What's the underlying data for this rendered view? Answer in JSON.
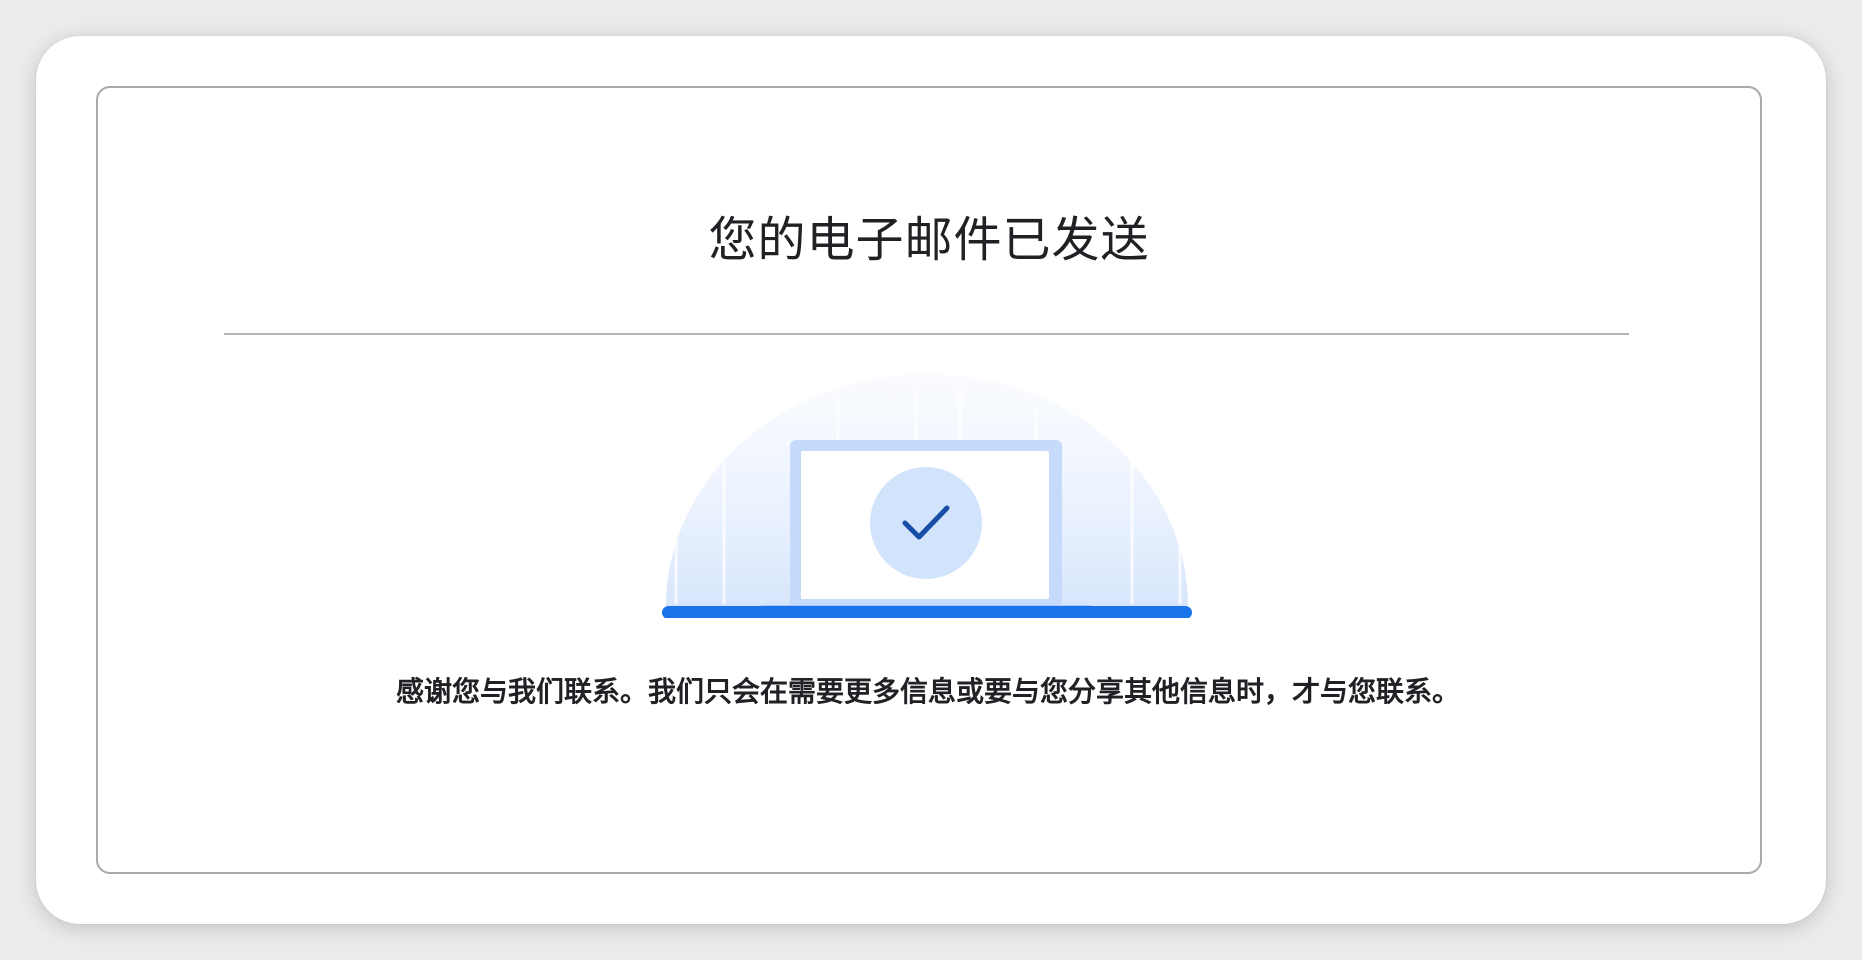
{
  "confirmation": {
    "title": "您的电子邮件已发送",
    "message": "感谢您与我们联系。我们只会在需要更多信息或要与您分享其他信息时，才与您联系。"
  },
  "illustration": {
    "icons": [
      "laptop-icon",
      "checkmark-icon"
    ],
    "colors": {
      "accent": "#1a73e8",
      "laptop_frame": "#c6dafc",
      "check_circle": "#d2e3fc",
      "check_mark": "#174ea6",
      "halo": "#e8f0fe"
    }
  }
}
